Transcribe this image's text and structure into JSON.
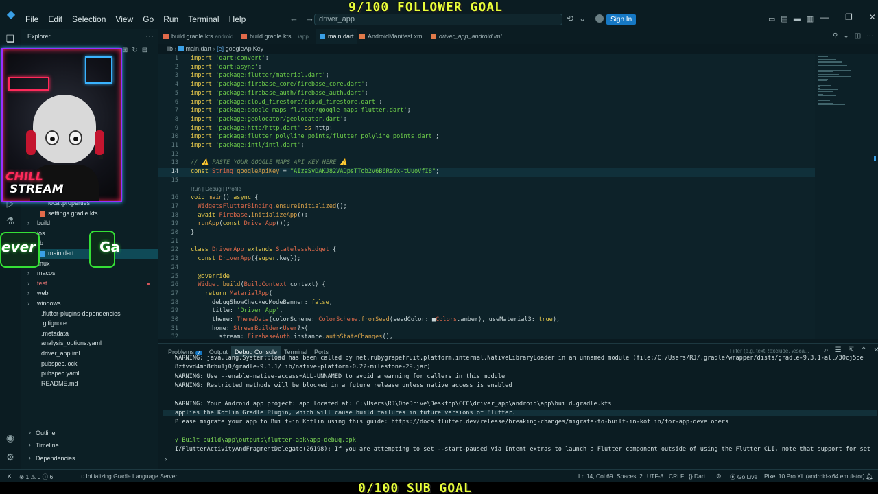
{
  "overlay": {
    "follower_goal": "9/100 FOLLOWER GOAL",
    "sub_goal": "0/100 SUB GOAL",
    "avatar_text_top": "CHILL",
    "avatar_text_bottom": "STREAM",
    "badge_left": "ever",
    "badge_right": "Ga"
  },
  "titlebar": {
    "menu": [
      "File",
      "Edit",
      "Selection",
      "View",
      "Go",
      "Run",
      "Terminal",
      "Help"
    ],
    "search_text": "driver_app",
    "signin_label": "Sign In"
  },
  "sidebar": {
    "title": "Explorer",
    "items": [
      {
        "label": "local.properties",
        "indent": 2
      },
      {
        "label": "settings.gradle.kts",
        "indent": 2
      },
      {
        "label": "build",
        "indent": 1,
        "folder": true
      },
      {
        "label": "ios",
        "indent": 1,
        "folder": true
      },
      {
        "label": "lib",
        "indent": 1,
        "folder": true,
        "open": true
      },
      {
        "label": "main.dart",
        "indent": 2,
        "selected": true
      },
      {
        "label": "linux",
        "indent": 1,
        "folder": true
      },
      {
        "label": "macos",
        "indent": 1,
        "folder": true
      },
      {
        "label": "test",
        "indent": 1,
        "folder": true,
        "error": true
      },
      {
        "label": "web",
        "indent": 1,
        "folder": true
      },
      {
        "label": "windows",
        "indent": 1,
        "folder": true
      },
      {
        "label": ".flutter-plugins-dependencies",
        "indent": 1
      },
      {
        "label": ".gitignore",
        "indent": 1
      },
      {
        "label": ".metadata",
        "indent": 1
      },
      {
        "label": "analysis_options.yaml",
        "indent": 1
      },
      {
        "label": "driver_app.iml",
        "indent": 1
      },
      {
        "label": "pubspec.lock",
        "indent": 1
      },
      {
        "label": "pubspec.yaml",
        "indent": 1
      },
      {
        "label": "README.md",
        "indent": 1
      }
    ],
    "sections": [
      "Outline",
      "Timeline",
      "Dependencies"
    ]
  },
  "tabs": [
    {
      "label": "build.gradle.kts",
      "sub": "android"
    },
    {
      "label": "build.gradle.kts",
      "sub": "...\\app"
    },
    {
      "label": "main.dart",
      "sub": "",
      "active": true
    },
    {
      "label": "AndroidManifest.xml",
      "sub": ""
    },
    {
      "label": "driver_app_android.iml",
      "sub": ""
    }
  ],
  "breadcrumb": {
    "folder": "lib",
    "file": "main.dart",
    "symbol": "googleApiKey"
  },
  "code": [
    {
      "n": "1",
      "t": "import 'dart:convert';"
    },
    {
      "n": "2",
      "t": "import 'dart:async';"
    },
    {
      "n": "3",
      "t": "import 'package:flutter/material.dart';"
    },
    {
      "n": "4",
      "t": "import 'package:firebase_core/firebase_core.dart';"
    },
    {
      "n": "5",
      "t": "import 'package:firebase_auth/firebase_auth.dart';"
    },
    {
      "n": "6",
      "t": "import 'package:cloud_firestore/cloud_firestore.dart';"
    },
    {
      "n": "7",
      "t": "import 'package:google_maps_flutter/google_maps_flutter.dart';"
    },
    {
      "n": "8",
      "t": "import 'package:geolocator/geolocator.dart';"
    },
    {
      "n": "9",
      "t": "import 'package:http/http.dart' as http;"
    },
    {
      "n": "10",
      "t": "import 'package:flutter_polyline_points/flutter_polyline_points.dart';"
    },
    {
      "n": "11",
      "t": "import 'package:intl/intl.dart';"
    },
    {
      "n": "12",
      "t": ""
    },
    {
      "n": "13",
      "t": "// ⚠️ PASTE YOUR GOOGLE MAPS API KEY HERE ⚠️"
    },
    {
      "n": "14",
      "t": "const String googleApiKey = \"AIzaSyDAKJ82VADpsTTob2v6B6Re9x-tUuoVfI8\";"
    },
    {
      "n": "15",
      "t": ""
    },
    {
      "n": "",
      "t": "Run | Debug | Profile"
    },
    {
      "n": "16",
      "t": "void main() async {"
    },
    {
      "n": "17",
      "t": "  WidgetsFlutterBinding.ensureInitialized();"
    },
    {
      "n": "18",
      "t": "  await Firebase.initializeApp();"
    },
    {
      "n": "19",
      "t": "  runApp(const DriverApp());"
    },
    {
      "n": "20",
      "t": "}"
    },
    {
      "n": "21",
      "t": ""
    },
    {
      "n": "22",
      "t": "class DriverApp extends StatelessWidget {"
    },
    {
      "n": "23",
      "t": "  const DriverApp({super.key});"
    },
    {
      "n": "24",
      "t": ""
    },
    {
      "n": "25",
      "t": "  @override"
    },
    {
      "n": "26",
      "t": "  Widget build(BuildContext context) {"
    },
    {
      "n": "27",
      "t": "    return MaterialApp("
    },
    {
      "n": "28",
      "t": "      debugShowCheckedModeBanner: false,"
    },
    {
      "n": "29",
      "t": "      title: 'Driver App',"
    },
    {
      "n": "30",
      "t": "      theme: ThemeData(colorScheme: ColorScheme.fromSeed(seedColor: ■Colors.amber), useMaterial3: true),"
    },
    {
      "n": "31",
      "t": "      home: StreamBuilder<User?>("
    },
    {
      "n": "32",
      "t": "        stream: FirebaseAuth.instance.authStateChanges(),"
    }
  ],
  "panel": {
    "tabs": [
      {
        "label": "Problems",
        "count": "7"
      },
      {
        "label": "Debug Console",
        "active": true
      },
      {
        "label": "Output"
      },
      {
        "label": "Terminal"
      },
      {
        "label": "Ports"
      }
    ],
    "filter_placeholder": "Filter (e.g. text, !exclude, \\esca...",
    "lines": [
      "WARNING: java.lang.System::load has been called by net.rubygrapefruit.platform.internal.NativeLibraryLoader in an unnamed module (file:/C:/Users/RJ/.gradle/wrapper/dists/gradle-9.3.1-all/30cj5oe",
      "8zfvvd4mn8rbu1j0/gradle-9.3.1/lib/native-platform-0.22-milestone-29.jar)",
      "WARNING: Use --enable-native-access=ALL-UNNAMED to avoid a warning for callers in this module",
      "WARNING: Restricted methods will be blocked in a future release unless native access is enabled",
      "",
      "WARNING: Your Android app project: app located at: C:\\Users\\RJ\\OneDrive\\Desktop\\CCC\\driver_app\\android\\app\\build.gradle.kts",
      "applies the Kotlin Gradle Plugin, which will cause build failures in future versions of Flutter.",
      "Please migrate your app to Built-in Kotlin using this guide: https://docs.flutter.dev/release/breaking-changes/migrate-to-built-in-kotlin/for-app-developers",
      "",
      "√ Built build\\app\\outputs\\flutter-apk\\app-debug.apk",
      "I/FlutterActivityAndFragmentDelegate(26198): If you are attempting to set --start-paused via Intent extras to launch a Flutter component outside of using the Flutter CLI, note that support for set"
    ]
  },
  "statusbar": {
    "errors": "1",
    "warnings": "0",
    "info": "6",
    "task": "Initializing Gradle Language Server",
    "position": "Ln 14, Col 69",
    "spaces": "Spaces: 2",
    "encoding": "UTF-8",
    "eol": "CRLF",
    "language": "Dart",
    "golive": "Go Live",
    "device": "Pixel 10 Pro XL (android-x64 emulator)"
  }
}
